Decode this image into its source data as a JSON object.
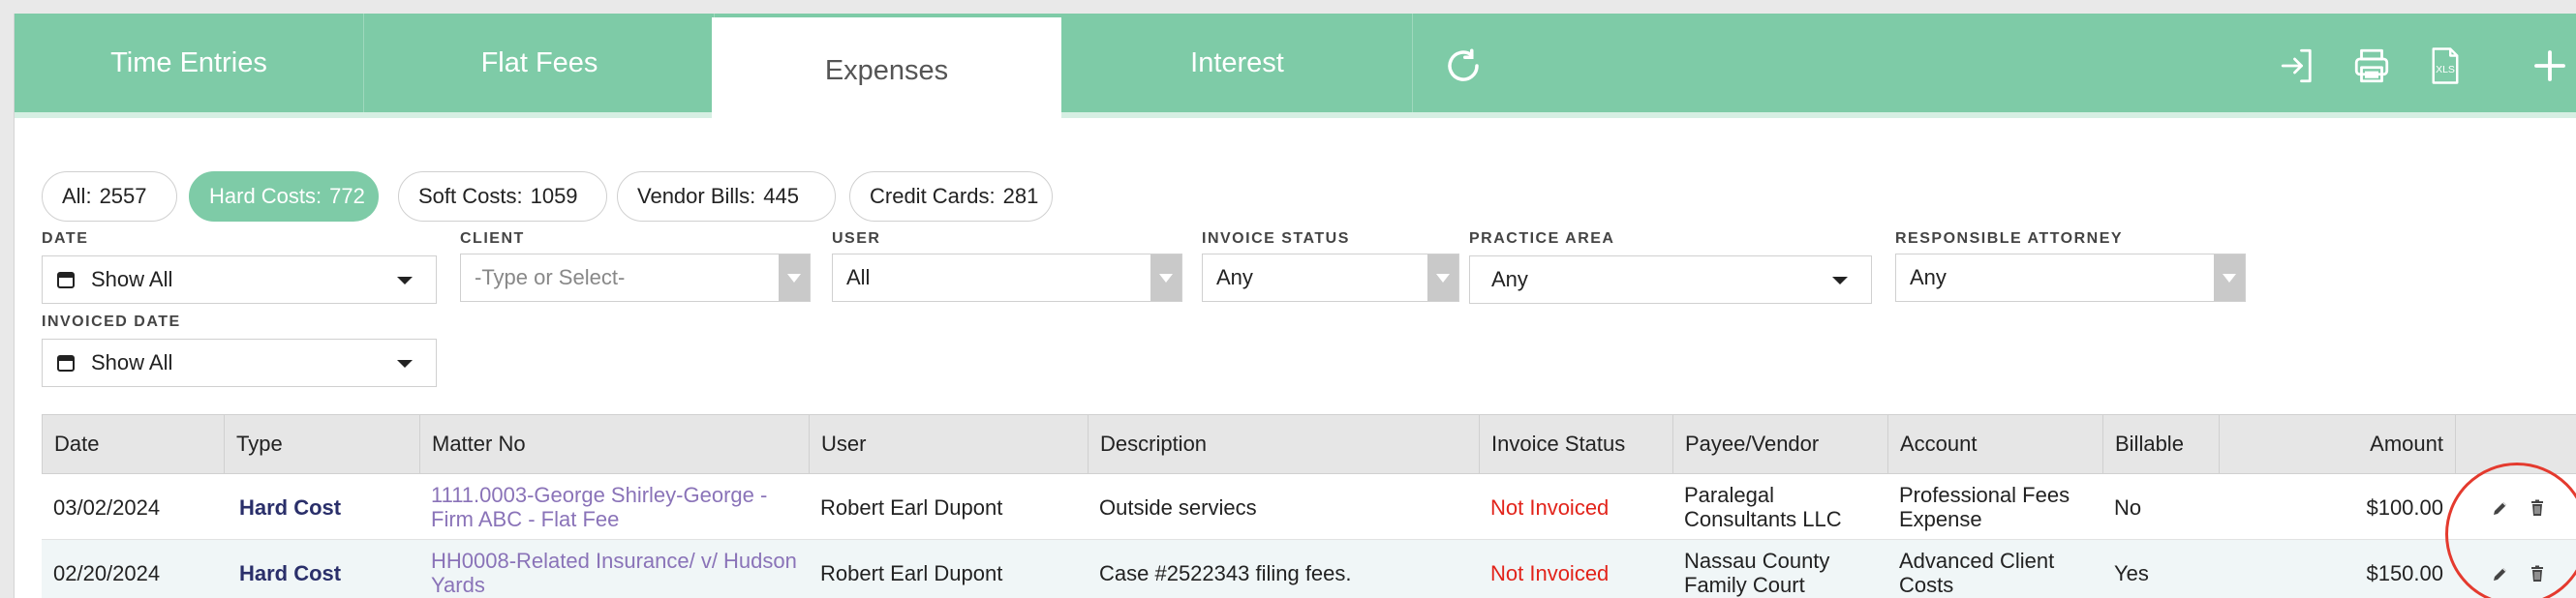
{
  "tabs": [
    {
      "label": "Time Entries",
      "active": false
    },
    {
      "label": "Flat Fees",
      "active": false
    },
    {
      "label": "Expenses",
      "active": true
    },
    {
      "label": "Interest",
      "active": false
    }
  ],
  "toolbar": {
    "refresh_icon": "refresh-icon",
    "login_icon": "sign-in-icon",
    "print_icon": "printer-icon",
    "xls_icon": "xls-export-icon",
    "add_icon": "plus-icon"
  },
  "pills": [
    {
      "label": "All:",
      "count": "2557"
    },
    {
      "label": "Hard Costs:",
      "count": "772"
    },
    {
      "label": "Soft Costs:",
      "count": "1059"
    },
    {
      "label": "Vendor Bills:",
      "count": "445"
    },
    {
      "label": "Credit Cards:",
      "count": "281"
    }
  ],
  "filters": {
    "date": {
      "label": "Date",
      "value": "Show All"
    },
    "client": {
      "label": "Client",
      "placeholder": "-Type or Select-"
    },
    "user": {
      "label": "User",
      "value": "All"
    },
    "invoice_status": {
      "label": "Invoice Status",
      "value": "Any"
    },
    "practice_area": {
      "label": "Practice Area",
      "value": "Any"
    },
    "responsible_attorney": {
      "label": "Responsible Attorney",
      "value": "Any"
    },
    "invoiced_date": {
      "label": "Invoiced Date",
      "value": "Show All"
    }
  },
  "table": {
    "columns": [
      "Date",
      "Type",
      "Matter No",
      "User",
      "Description",
      "Invoice Status",
      "Payee/Vendor",
      "Account",
      "Billable",
      "Amount"
    ],
    "rows": [
      {
        "date": "03/02/2024",
        "type": "Hard Cost",
        "matter_line1": "1111.0003-George Shirley-George -",
        "matter_line2": "Firm ABC - Flat Fee",
        "user": "Robert Earl Dupont",
        "description": "Outside serviecs",
        "invoice_status": "Not Invoiced",
        "payee_line1": "Paralegal",
        "payee_line2": "Consultants LLC",
        "account_line1": "Professional Fees",
        "account_line2": "Expense",
        "billable": "No",
        "amount": "$100.00"
      },
      {
        "date": "02/20/2024",
        "type": "Hard Cost",
        "matter_line1": "HH0008-Related Insurance/ v/ Hudson",
        "matter_line2": "Yards",
        "user": "Robert Earl Dupont",
        "description": "Case #2522343 filing fees.",
        "invoice_status": "Not Invoiced",
        "payee_line1": "Nassau County",
        "payee_line2": "Family Court",
        "account_line1": "Advanced Client",
        "account_line2": "Costs",
        "billable": "Yes",
        "amount": "$150.00"
      }
    ]
  },
  "colors": {
    "accent": "#7ecba7",
    "link": "#8a73b8",
    "status_red": "#e2231a",
    "type_navy": "#2a2f6a",
    "highlight_ring": "#e43a2e"
  }
}
